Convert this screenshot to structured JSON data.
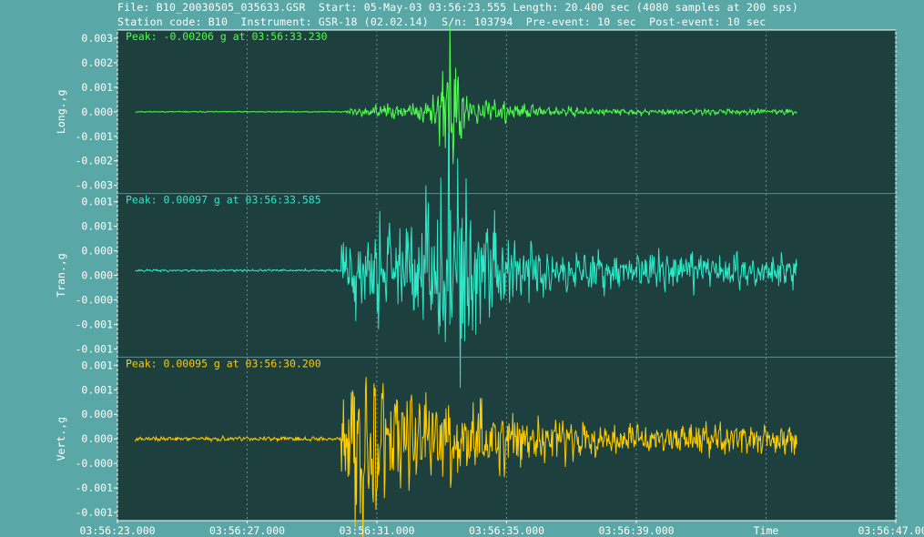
{
  "header": {
    "line1": "File: B10_20030505_035633.GSR  Start: 05-May-03 03:56:23.555 Length: 20.400 sec (4080 samples at 200 sps)",
    "line2": "Station code: B10  Instrument: GSR-18 (02.02.14)  S/n: 103794  Pre-event: 10 sec  Post-event: 10 sec"
  },
  "colors": {
    "background": "#5aa7a7",
    "plot_background": "#1d3f3e",
    "long": "#4dff4d",
    "tran": "#2ee8c8",
    "vert": "#ffcc00",
    "axis_text": "#ffffff"
  },
  "chart_data": {
    "type": "line",
    "x_axis": {
      "label": "Time",
      "start_seconds": 0,
      "end_seconds": 24,
      "tick_labels": [
        "03:56:23.000",
        "03:56:27.000",
        "03:56:31.000",
        "03:56:35.000",
        "03:56:39.000",
        "03:56:47.000"
      ],
      "tick_seconds": [
        0,
        4,
        8,
        12,
        16,
        24
      ],
      "grid_seconds": [
        0,
        4,
        8,
        12,
        16,
        20,
        24
      ],
      "grid": true
    },
    "panels": [
      {
        "key": "long",
        "ylabel": "Long.,g",
        "peak_label": "Peak: -0.00206 g at 03:56:33.230",
        "yticks": [
          "0.003",
          "0.002",
          "0.001",
          "0.000",
          "-0.001",
          "-0.002",
          "-0.003"
        ],
        "ylim": [
          -0.003,
          0.003
        ],
        "signal_start": 0.55,
        "signal_end": 20.95,
        "event_onset": 7.0,
        "noise_level": 1e-05,
        "coda_level": 4e-05,
        "peak_time": 10.23,
        "peak_value": -0.00206,
        "peak_amp": 0.0011,
        "peak_width": 0.35,
        "mid_amp": 0.00018,
        "mid_time": 10.5,
        "mid_width": 2.5,
        "seed": 11
      },
      {
        "key": "tran",
        "ylabel": "Tran.,g",
        "peak_label": "Peak: 0.00097 g at 03:56:33.585",
        "yticks": [
          "0.001",
          "0.001",
          "0.000",
          "0.000",
          "-0.000",
          "-0.001",
          "-0.001"
        ],
        "ylim": [
          -0.0015,
          0.0015
        ],
        "offset": 0.0001,
        "signal_start": 0.55,
        "signal_end": 20.95,
        "event_onset": 6.9,
        "noise_level": 1e-05,
        "coda_level": 0.00015,
        "peak_time": 10.58,
        "peak_value": 0.00097,
        "peak_amp": 0.00055,
        "peak_width": 0.9,
        "mid_amp": 0.00035,
        "mid_time": 9.0,
        "mid_width": 3.5,
        "seed": 23
      },
      {
        "key": "vert",
        "ylabel": "Vert.,g",
        "peak_label": "Peak: 0.00095 g at 03:56:30.200",
        "yticks": [
          "0.001",
          "0.001",
          "0.000",
          "0.000",
          "-0.000",
          "-0.001",
          "-0.001"
        ],
        "ylim": [
          -0.0015,
          0.0015
        ],
        "signal_start": 0.55,
        "signal_end": 20.95,
        "event_onset": 6.9,
        "noise_level": 2e-05,
        "coda_level": 0.00012,
        "peak_time": 7.2,
        "peak_value": 0.00095,
        "peak_amp": 0.00045,
        "peak_width": 1.2,
        "mid_amp": 0.0003,
        "mid_time": 9.5,
        "mid_width": 3.5,
        "seed": 37
      }
    ]
  }
}
